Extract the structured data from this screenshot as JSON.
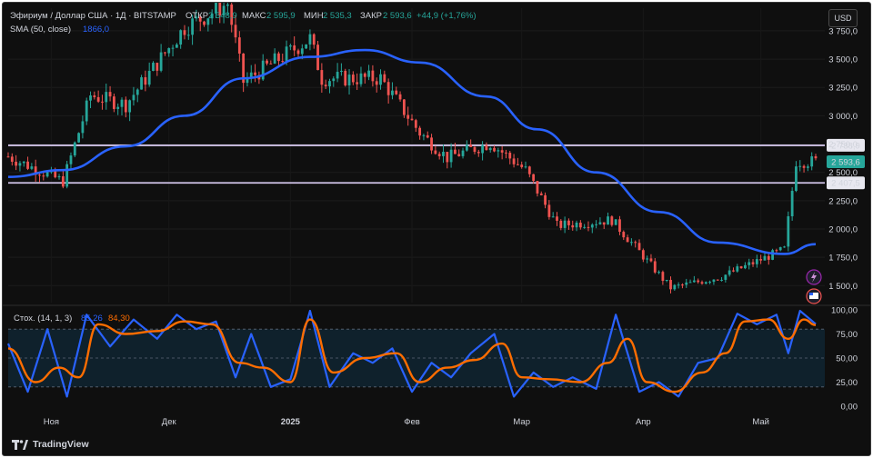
{
  "header": {
    "symbol_title": "Эфириум / Доллар США · 1Д · BITSTAMP",
    "open_label": "ОТКР",
    "open_value": "2 548,9",
    "high_label": "МАКС",
    "high_value": "2 595,9",
    "low_label": "МИН",
    "low_value": "2 535,3",
    "close_label": "ЗАКР",
    "close_value": "2 593,6",
    "change_value": "+44,9 (+1,76%)",
    "sma_label": "SMA (50, close)",
    "sma_value": "1866,0"
  },
  "currency_button": "USD",
  "stoch": {
    "label": "Стох. (14, 1, 3)",
    "k_value": "85,26",
    "d_value": "84,30"
  },
  "brand": "TradingView",
  "colors": {
    "up": "#26a69a",
    "down": "#ef5350",
    "sma": "#2962ff",
    "stoch_k": "#2962ff",
    "stoch_d": "#ff6d00",
    "level_line": "#d1c4e9"
  },
  "chart_data": {
    "type": "candlestick",
    "y_ticks": [
      "3 750,0",
      "3 500,0",
      "3 250,0",
      "3 000,0",
      "2 750,0",
      "2 500,0",
      "2 250,0",
      "2 000,0",
      "1 750,0",
      "1 500,0"
    ],
    "ylim": [
      1350,
      3950
    ],
    "x_tick_labels": [
      "Ноя",
      "Дек",
      "2025",
      "Фев",
      "Мар",
      "Апр",
      "Май"
    ],
    "x_tick_dates": [
      "2024-11-01",
      "2024-12-01",
      "2025-01-01",
      "2025-02-01",
      "2025-03-01",
      "2025-04-01",
      "2025-05-01"
    ],
    "date_range": [
      "2024-10-21",
      "2025-05-15"
    ],
    "horizontal_levels": [
      {
        "value": 2738.9,
        "label": "2 738,9"
      },
      {
        "value": 2407.5,
        "label": "2 407,5"
      }
    ],
    "last_price": {
      "value": 2593.6,
      "label": "2 593,6"
    },
    "key_closes": [
      {
        "date": "2024-10-21",
        "close": 2640
      },
      {
        "date": "2024-11-04",
        "close": 2420
      },
      {
        "date": "2024-11-11",
        "close": 3180
      },
      {
        "date": "2024-11-20",
        "close": 3100
      },
      {
        "date": "2024-12-05",
        "close": 3780
      },
      {
        "date": "2024-12-16",
        "close": 3990
      },
      {
        "date": "2024-12-20",
        "close": 3300
      },
      {
        "date": "2025-01-06",
        "close": 3680
      },
      {
        "date": "2025-01-09",
        "close": 3330
      },
      {
        "date": "2025-01-24",
        "close": 3330
      },
      {
        "date": "2025-02-03",
        "close": 2850
      },
      {
        "date": "2025-02-10",
        "close": 2630
      },
      {
        "date": "2025-02-21",
        "close": 2760
      },
      {
        "date": "2025-03-02",
        "close": 2520
      },
      {
        "date": "2025-03-10",
        "close": 2030
      },
      {
        "date": "2025-03-24",
        "close": 2080
      },
      {
        "date": "2025-04-08",
        "close": 1480
      },
      {
        "date": "2025-04-21",
        "close": 1580
      },
      {
        "date": "2025-05-07",
        "close": 1820
      },
      {
        "date": "2025-05-10",
        "close": 2600
      },
      {
        "date": "2025-05-15",
        "close": 2593.6
      }
    ],
    "sma_points": [
      {
        "date": "2024-10-21",
        "value": 2460
      },
      {
        "date": "2024-11-04",
        "value": 2520
      },
      {
        "date": "2024-11-20",
        "value": 2730
      },
      {
        "date": "2024-12-05",
        "value": 3000
      },
      {
        "date": "2024-12-20",
        "value": 3330
      },
      {
        "date": "2025-01-06",
        "value": 3520
      },
      {
        "date": "2025-01-20",
        "value": 3580
      },
      {
        "date": "2025-02-03",
        "value": 3470
      },
      {
        "date": "2025-02-20",
        "value": 3170
      },
      {
        "date": "2025-03-05",
        "value": 2880
      },
      {
        "date": "2025-03-20",
        "value": 2500
      },
      {
        "date": "2025-04-05",
        "value": 2150
      },
      {
        "date": "2025-04-20",
        "value": 1880
      },
      {
        "date": "2025-05-07",
        "value": 1780
      },
      {
        "date": "2025-05-15",
        "value": 1866
      }
    ],
    "stochastic": {
      "ylim": [
        0,
        100
      ],
      "y_ticks": [
        "100,00",
        "75,00",
        "50,00",
        "25,00",
        "0,00"
      ],
      "band": [
        20,
        80
      ],
      "k_points": [
        {
          "date": "2024-10-21",
          "value": 65
        },
        {
          "date": "2024-10-26",
          "value": 15
        },
        {
          "date": "2024-10-31",
          "value": 80
        },
        {
          "date": "2024-11-05",
          "value": 10
        },
        {
          "date": "2024-11-10",
          "value": 95
        },
        {
          "date": "2024-11-16",
          "value": 62
        },
        {
          "date": "2024-11-22",
          "value": 90
        },
        {
          "date": "2024-11-28",
          "value": 70
        },
        {
          "date": "2024-12-03",
          "value": 95
        },
        {
          "date": "2024-12-08",
          "value": 80
        },
        {
          "date": "2024-12-13",
          "value": 88
        },
        {
          "date": "2024-12-18",
          "value": 30
        },
        {
          "date": "2024-12-22",
          "value": 75
        },
        {
          "date": "2024-12-27",
          "value": 20
        },
        {
          "date": "2025-01-01",
          "value": 28
        },
        {
          "date": "2025-01-06",
          "value": 99
        },
        {
          "date": "2025-01-11",
          "value": 20
        },
        {
          "date": "2025-01-17",
          "value": 55
        },
        {
          "date": "2025-01-22",
          "value": 45
        },
        {
          "date": "2025-01-27",
          "value": 60
        },
        {
          "date": "2025-02-01",
          "value": 15
        },
        {
          "date": "2025-02-06",
          "value": 45
        },
        {
          "date": "2025-02-11",
          "value": 30
        },
        {
          "date": "2025-02-16",
          "value": 55
        },
        {
          "date": "2025-02-22",
          "value": 75
        },
        {
          "date": "2025-02-27",
          "value": 10
        },
        {
          "date": "2025-03-04",
          "value": 35
        },
        {
          "date": "2025-03-09",
          "value": 20
        },
        {
          "date": "2025-03-14",
          "value": 30
        },
        {
          "date": "2025-03-20",
          "value": 18
        },
        {
          "date": "2025-03-25",
          "value": 95
        },
        {
          "date": "2025-03-31",
          "value": 15
        },
        {
          "date": "2025-04-05",
          "value": 25
        },
        {
          "date": "2025-04-10",
          "value": 10
        },
        {
          "date": "2025-04-15",
          "value": 45
        },
        {
          "date": "2025-04-20",
          "value": 50
        },
        {
          "date": "2025-04-25",
          "value": 96
        },
        {
          "date": "2025-04-30",
          "value": 85
        },
        {
          "date": "2025-05-05",
          "value": 95
        },
        {
          "date": "2025-05-08",
          "value": 55
        },
        {
          "date": "2025-05-11",
          "value": 99
        },
        {
          "date": "2025-05-15",
          "value": 85.26
        }
      ],
      "d_points": [
        {
          "date": "2024-10-21",
          "value": 60
        },
        {
          "date": "2024-10-28",
          "value": 25
        },
        {
          "date": "2024-11-03",
          "value": 40
        },
        {
          "date": "2024-11-08",
          "value": 30
        },
        {
          "date": "2024-11-13",
          "value": 85
        },
        {
          "date": "2024-11-20",
          "value": 75
        },
        {
          "date": "2024-11-28",
          "value": 78
        },
        {
          "date": "2024-12-05",
          "value": 88
        },
        {
          "date": "2024-12-12",
          "value": 85
        },
        {
          "date": "2024-12-19",
          "value": 45
        },
        {
          "date": "2024-12-25",
          "value": 40
        },
        {
          "date": "2025-01-01",
          "value": 25
        },
        {
          "date": "2025-01-06",
          "value": 90
        },
        {
          "date": "2025-01-12",
          "value": 35
        },
        {
          "date": "2025-01-20",
          "value": 50
        },
        {
          "date": "2025-01-28",
          "value": 55
        },
        {
          "date": "2025-02-03",
          "value": 25
        },
        {
          "date": "2025-02-10",
          "value": 40
        },
        {
          "date": "2025-02-17",
          "value": 48
        },
        {
          "date": "2025-02-24",
          "value": 65
        },
        {
          "date": "2025-03-01",
          "value": 30
        },
        {
          "date": "2025-03-08",
          "value": 28
        },
        {
          "date": "2025-03-16",
          "value": 25
        },
        {
          "date": "2025-03-23",
          "value": 45
        },
        {
          "date": "2025-03-28",
          "value": 70
        },
        {
          "date": "2025-04-02",
          "value": 25
        },
        {
          "date": "2025-04-09",
          "value": 15
        },
        {
          "date": "2025-04-16",
          "value": 35
        },
        {
          "date": "2025-04-22",
          "value": 55
        },
        {
          "date": "2025-04-27",
          "value": 88
        },
        {
          "date": "2025-05-03",
          "value": 90
        },
        {
          "date": "2025-05-08",
          "value": 70
        },
        {
          "date": "2025-05-12",
          "value": 90
        },
        {
          "date": "2025-05-15",
          "value": 84.3
        }
      ]
    }
  }
}
